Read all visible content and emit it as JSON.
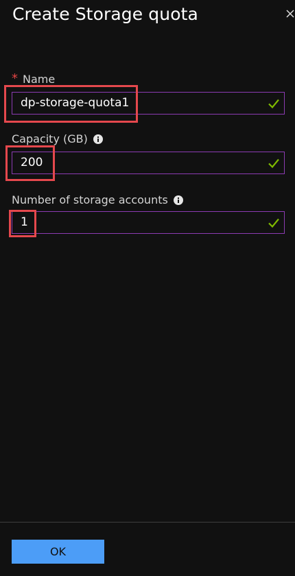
{
  "blade": {
    "title": "Create Storage quota"
  },
  "form": {
    "name": {
      "required_mark": "*",
      "label": "Name",
      "value": "dp-storage-quota1",
      "valid_icon": "checkmark-icon"
    },
    "capacity": {
      "label": "Capacity (GB)",
      "info_icon": "info-icon",
      "value": "200",
      "valid_icon": "checkmark-icon"
    },
    "storage_accounts": {
      "label": "Number of storage accounts",
      "info_icon": "info-icon",
      "value": "1",
      "valid_icon": "checkmark-icon"
    }
  },
  "footer": {
    "ok_label": "OK"
  },
  "colors": {
    "background": "#111111",
    "field_border": "#8d3bb3",
    "valid_check": "#7fba00",
    "required_star": "#e34444",
    "highlight_box": "#e5484d",
    "primary_button": "#4c9df7"
  }
}
